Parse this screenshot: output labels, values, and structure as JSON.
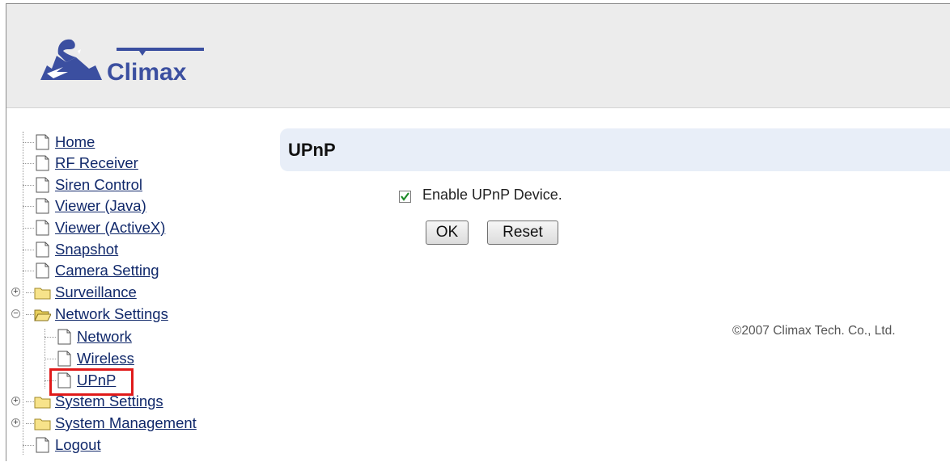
{
  "brand": {
    "logo_text": "Climax"
  },
  "nav": {
    "items": [
      {
        "label": "Home",
        "type": "page"
      },
      {
        "label": "RF Receiver",
        "type": "page"
      },
      {
        "label": "Siren Control",
        "type": "page"
      },
      {
        "label": "Viewer (Java)",
        "type": "page"
      },
      {
        "label": "Viewer (ActiveX)",
        "type": "page"
      },
      {
        "label": "Snapshot",
        "type": "page"
      },
      {
        "label": "Camera Setting",
        "type": "page"
      },
      {
        "label": "Surveillance",
        "type": "folder",
        "expanded": false
      },
      {
        "label": "Network Settings",
        "type": "folder",
        "expanded": true,
        "children": [
          {
            "label": "Network",
            "type": "page"
          },
          {
            "label": "Wireless",
            "type": "page"
          },
          {
            "label": "UPnP",
            "type": "page",
            "selected": true
          }
        ]
      },
      {
        "label": "System Settings",
        "type": "folder",
        "expanded": false
      },
      {
        "label": "System Management",
        "type": "folder",
        "expanded": false
      },
      {
        "label": "Logout",
        "type": "page"
      }
    ]
  },
  "page": {
    "title": "UPnP",
    "enable_upnp": {
      "label": "Enable UPnP Device.",
      "checked": true
    },
    "ok_label": "OK",
    "reset_label": "Reset"
  },
  "footer": {
    "copyright": "©2007 Climax Tech. Co., Ltd."
  },
  "colors": {
    "link": "#10286a",
    "title_bar": "#e8eef8",
    "highlight": "#e01a1a",
    "header_bg": "#ececec"
  }
}
